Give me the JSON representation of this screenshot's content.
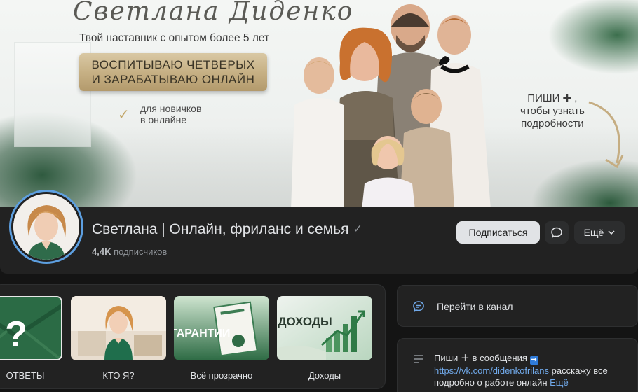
{
  "cover": {
    "title": "Светлана Диденко",
    "subtitle": "Твой наставник с опытом более 5 лет",
    "badge_line1": "ВОСПИТЫВАЮ ЧЕТВЕРЫХ",
    "badge_line2": "И ЗАРАБАТЫВАЮ ОНЛАЙН",
    "beginners_line1": "для новичков",
    "beginners_line2": "в онлайне",
    "cta_line1": "ПИШИ ✚ ,",
    "cta_line2": "чтобы узнать",
    "cta_line3": "подробности"
  },
  "profile": {
    "name": "Светлана | Онлайн, фриланс и семья",
    "subscribers_count": "4,4K",
    "subscribers_label": "подписчиков",
    "subscribe_label": "Подписаться",
    "more_label": "Ещё"
  },
  "highlights": [
    {
      "label": "ОТВЕТЫ"
    },
    {
      "label": "КТО Я?"
    },
    {
      "label": "Всё прозрачно",
      "thumb_text": "ГАРАНТИИ"
    },
    {
      "label": "Доходы",
      "thumb_text": "ДОХОДЫ"
    }
  ],
  "sidebar": {
    "go_to_channel": "Перейти в канал",
    "about_line1_text": "Пиши ",
    "about_line1_plus": "＋",
    "about_line1_rest": " в сообщения ",
    "about_link": "https://vk.com/didenkofrilans",
    "about_line2_rest": " расскажу все",
    "about_line3": "подробно о работе онлайн",
    "about_more": "Ещё"
  },
  "colors": {
    "background": "#141414",
    "card": "#222222",
    "accent_link": "#71aaeb",
    "avatar_ring": "#5d9fe0",
    "badge_gold": "#c7b185"
  }
}
